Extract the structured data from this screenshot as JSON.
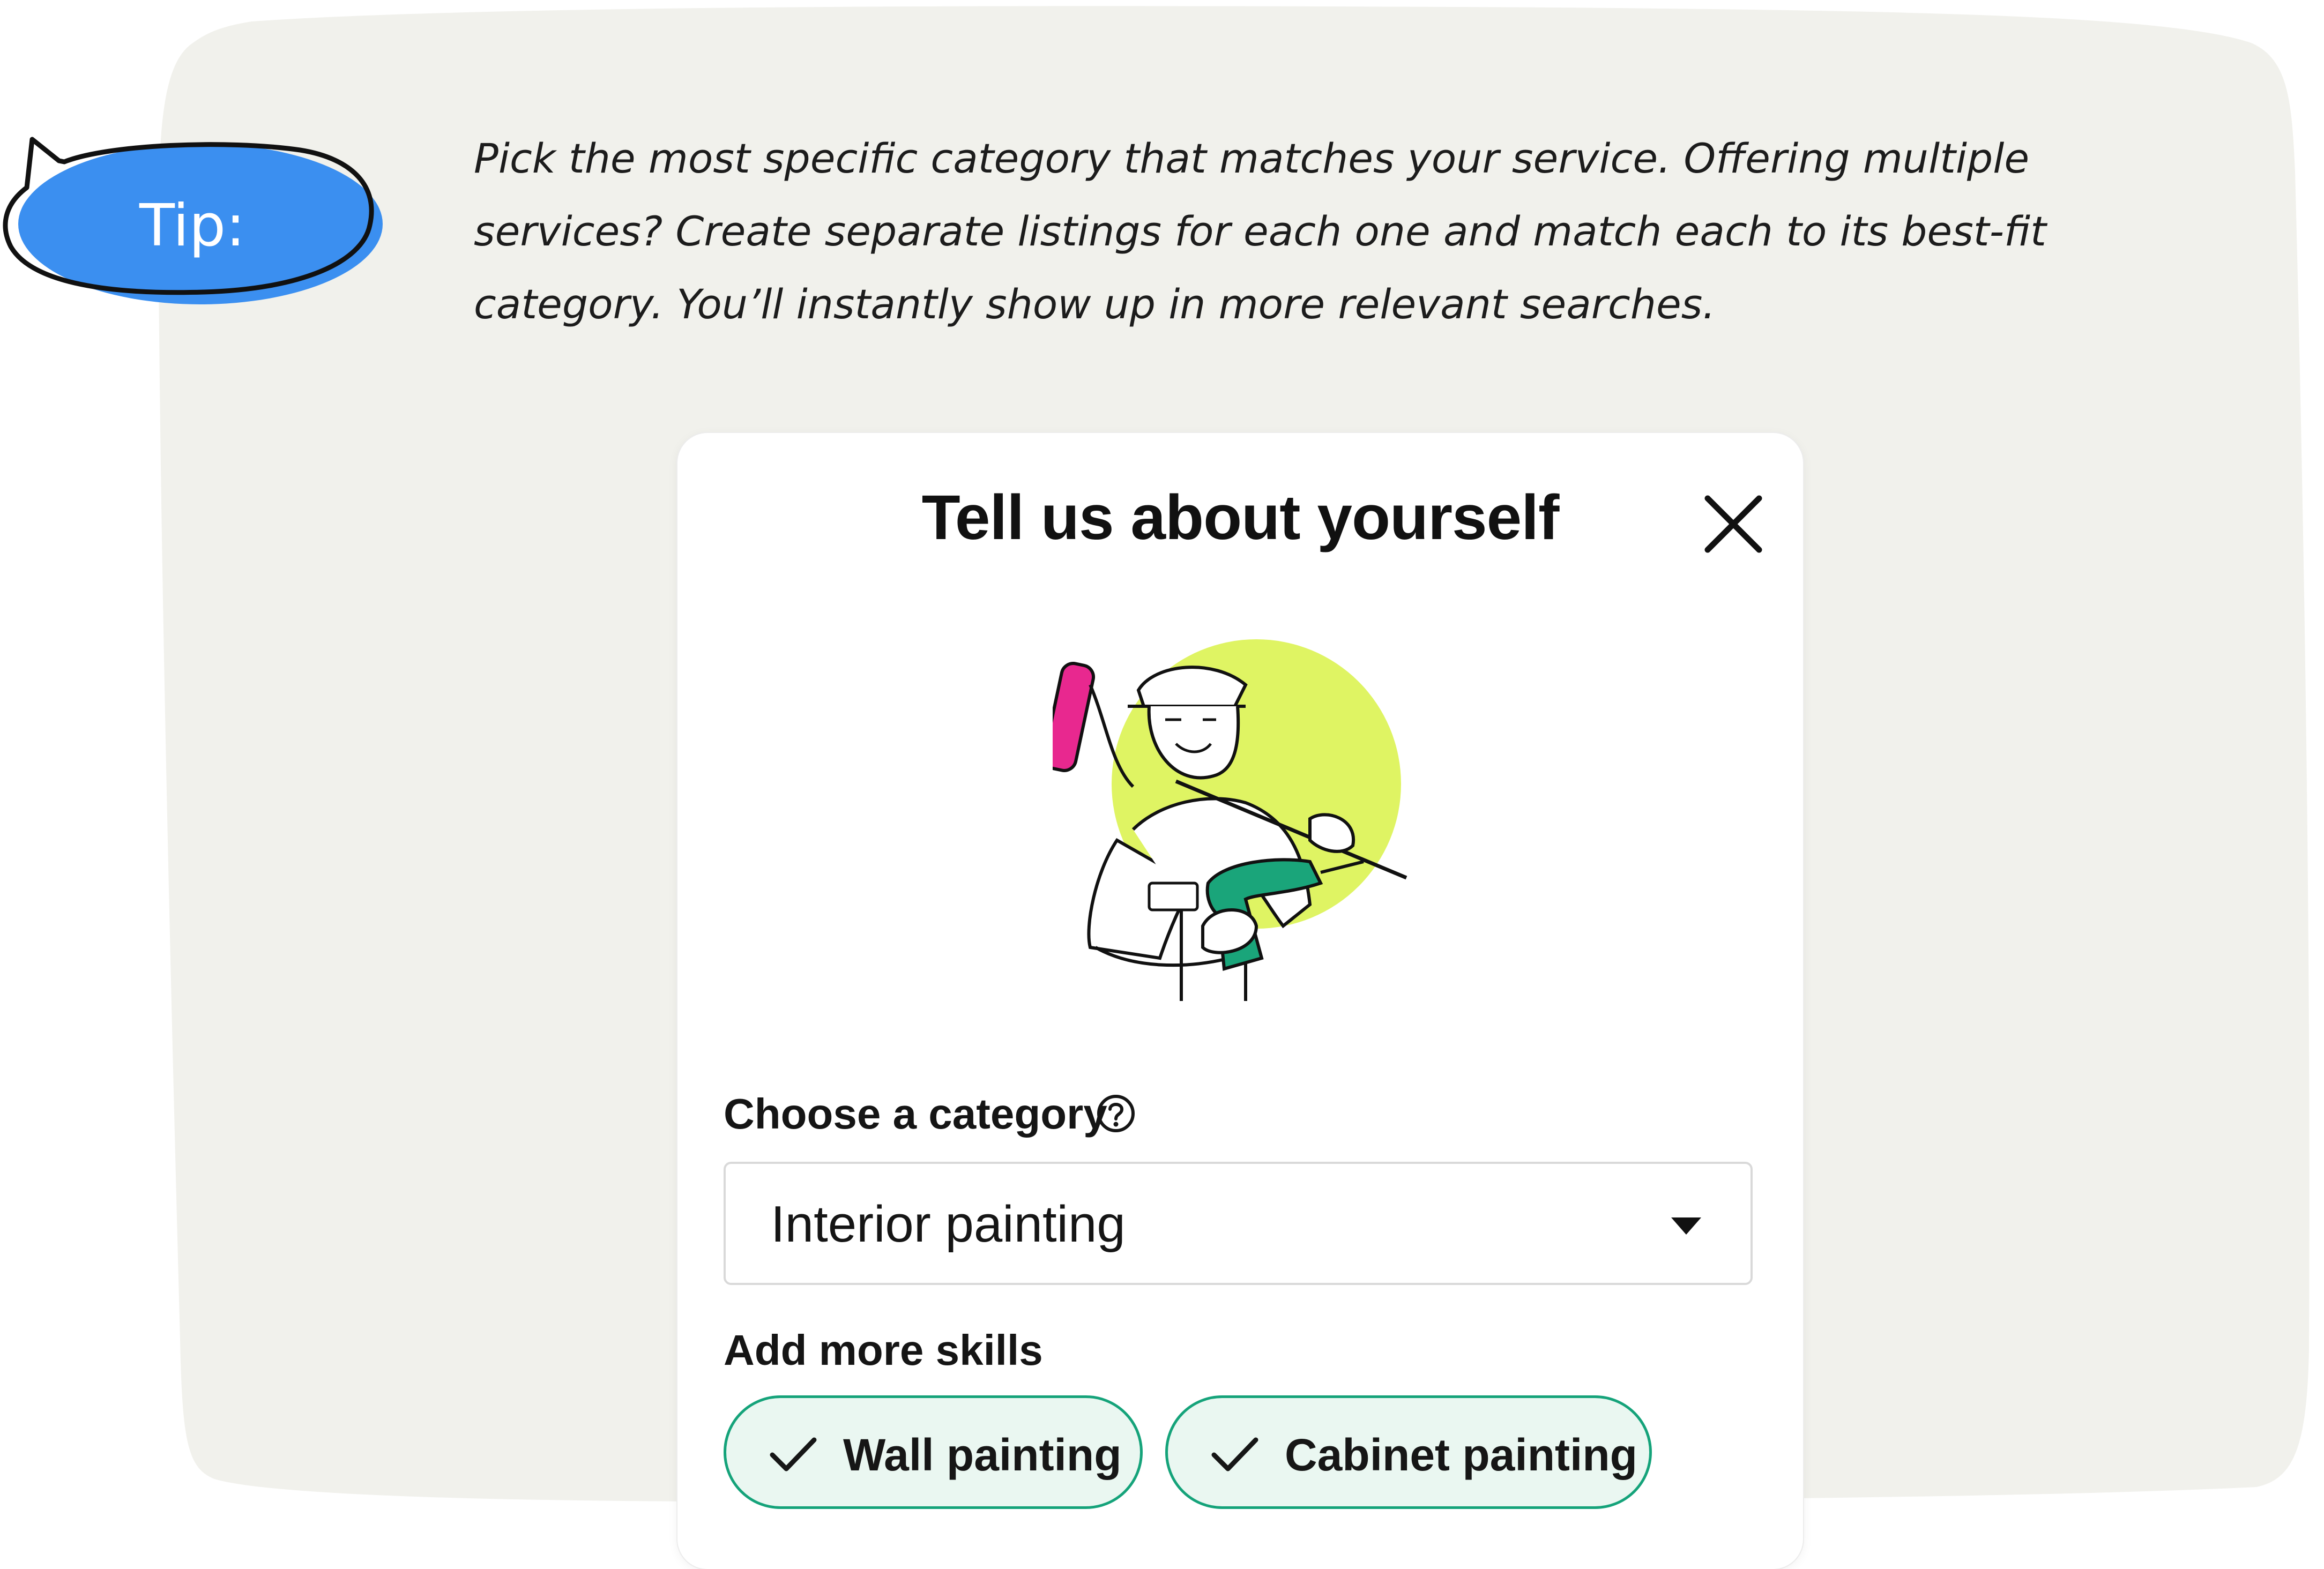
{
  "tip": {
    "badge_label": "Tip:",
    "text": "Pick the most specific category that matches your service. Offering multiple services? Create separate listings for each one and match each to its best-fit category. You’ll instantly show up in more relevant searches."
  },
  "dialog": {
    "title": "Tell us about yourself",
    "close_icon": "close-icon",
    "illustration": "painter-with-roller-and-drill"
  },
  "category": {
    "label": "Choose a category",
    "help_icon": "question-circle-icon",
    "selected_value": "Interior painting",
    "caret_icon": "caret-down-icon"
  },
  "skills": {
    "label": "Add more skills",
    "chips": [
      {
        "label": "Wall painting",
        "selected": true
      },
      {
        "label": "Cabinet painting",
        "selected": true
      }
    ]
  },
  "colors": {
    "background_blob": "#f1f1ec",
    "tip_badge": "#3b8ff0",
    "chip_border": "#15a37a",
    "chip_fill": "#eaf7f1",
    "illustration_circle": "#dff463",
    "roller": "#e8288f",
    "drill": "#1aa57a"
  }
}
